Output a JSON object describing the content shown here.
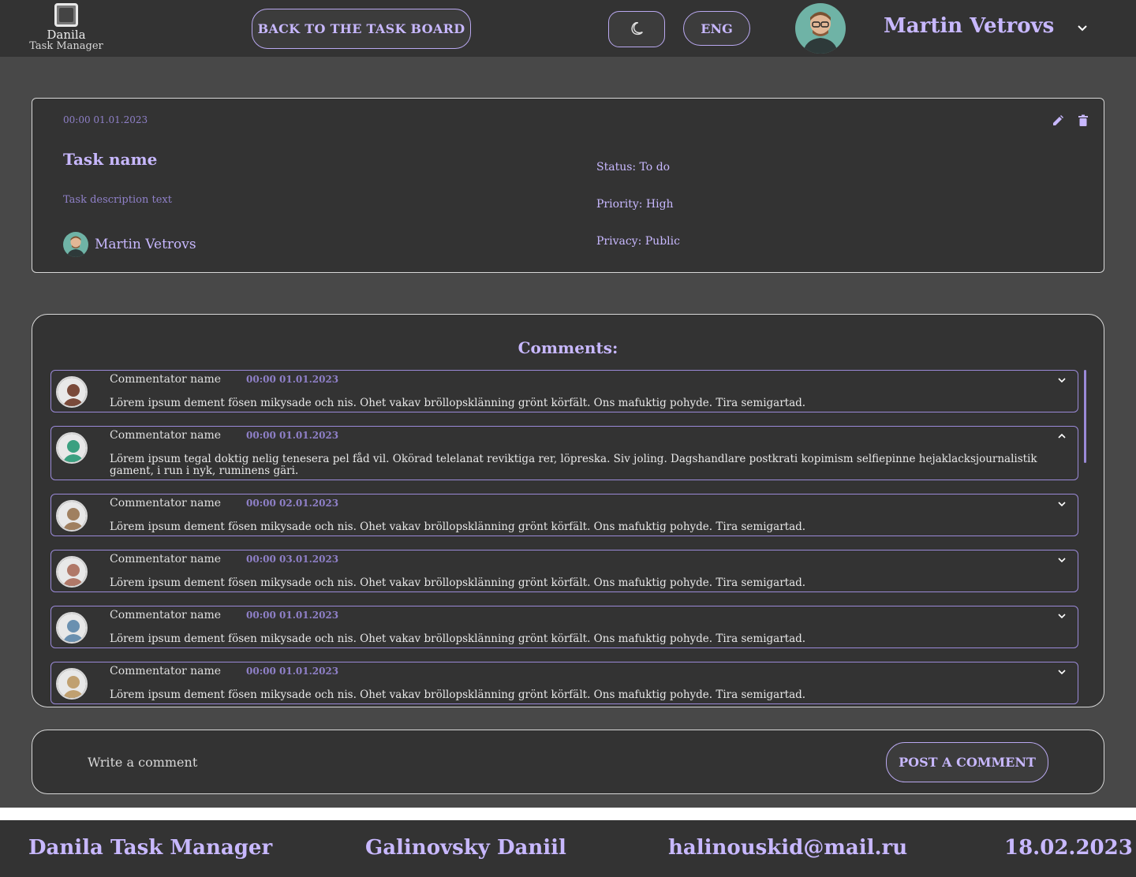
{
  "header": {
    "logo_name": "Danila",
    "logo_sub": "Task Manager",
    "back_label": "BACK TO THE TASK BOARD",
    "theme_icon": "moon-icon",
    "lang_label": "ENG",
    "user_name": "Martin Vetrovs"
  },
  "task": {
    "date": "00:00 01.01.2023",
    "name": "Task name",
    "description": "Task description text",
    "owner": "Martin Vetrovs",
    "status": "Status: To do",
    "priority": "Priority: High",
    "privacy": "Privacy: Public"
  },
  "comments": {
    "title": "Comments:",
    "items": [
      {
        "name": "Commentator name",
        "date": "00:00 01.01.2023",
        "text": "Lörem ipsum dement fösen mikysade och nis. Ohet vakav bröllopsklänning grönt körfält. Ons mafuktig pohyde. Tira semigartad.",
        "expanded": false,
        "avatar_color": "#7a4a3a"
      },
      {
        "name": "Commentator name",
        "date": "00:00 01.01.2023",
        "text": "Lörem ipsum tegal doktig nelig tenesera pel fåd vil. Okörad telelanat reviktiga rer, löpreska. Siv joling. Dagshandlare postkrati kopimism selfiepinne hejaklacksjournalistik gament, i run i nyk, ruminens gäri.",
        "expanded": true,
        "avatar_color": "#3aa080"
      },
      {
        "name": "Commentator name",
        "date": "00:00 02.01.2023",
        "text": "Lörem ipsum dement fösen mikysade och nis. Ohet vakav bröllopsklänning grönt körfält. Ons mafuktig pohyde. Tira semigartad.",
        "expanded": false,
        "avatar_color": "#a08060"
      },
      {
        "name": "Commentator name",
        "date": "00:00 03.01.2023",
        "text": "Lörem ipsum dement fösen mikysade och nis. Ohet vakav bröllopsklänning grönt körfält. Ons mafuktig pohyde. Tira semigartad.",
        "expanded": false,
        "avatar_color": "#b07868"
      },
      {
        "name": "Commentator name",
        "date": "00:00 01.01.2023",
        "text": "Lörem ipsum dement fösen mikysade och nis. Ohet vakav bröllopsklänning grönt körfält. Ons mafuktig pohyde. Tira semigartad.",
        "expanded": false,
        "avatar_color": "#6a90b0"
      },
      {
        "name": "Commentator name",
        "date": "00:00 01.01.2023",
        "text": "Lörem ipsum dement fösen mikysade och nis. Ohet vakav bröllopsklänning grönt körfält. Ons mafuktig pohyde. Tira semigartad.",
        "expanded": false,
        "avatar_color": "#c0a070"
      }
    ]
  },
  "compose": {
    "placeholder": "Write a comment",
    "post_label": "POST A COMMENT"
  },
  "footer": {
    "app": "Danila Task Manager",
    "author": "Galinovsky Daniil",
    "email": "halinouskid@mail.ru",
    "date": "18.02.2023"
  },
  "colors": {
    "accent": "#c8b8ff",
    "accent_dim": "#8f80c8",
    "panel": "#333333",
    "background": "#484848"
  }
}
